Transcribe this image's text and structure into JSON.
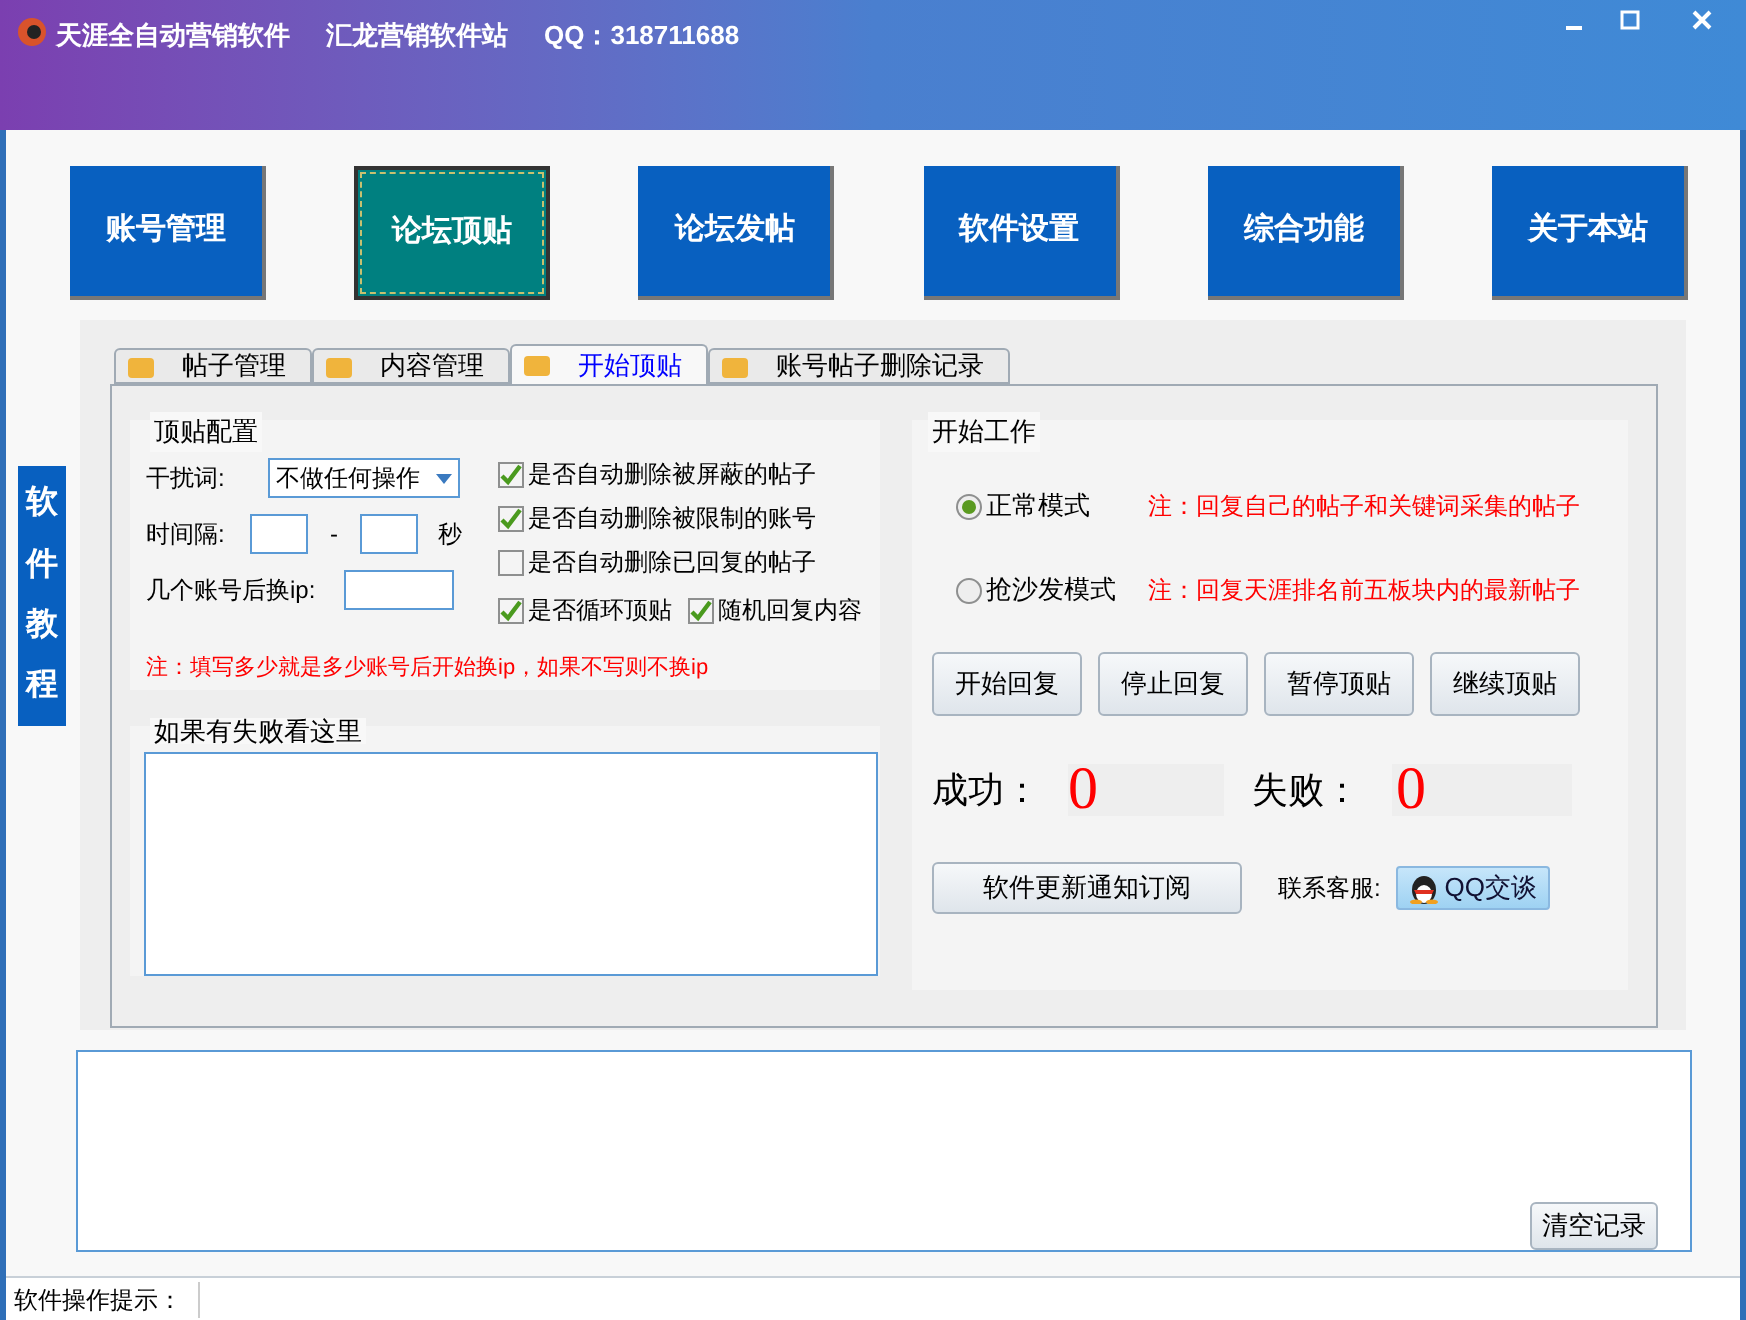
{
  "window": {
    "app_name": "天涯全自动营销软件",
    "site_name": "汇龙营销软件站",
    "qq": "QQ：318711688"
  },
  "nav_buttons": [
    {
      "label": "账号管理",
      "selected": false
    },
    {
      "label": "论坛顶贴",
      "selected": true
    },
    {
      "label": "论坛发帖",
      "selected": false
    },
    {
      "label": "软件设置",
      "selected": false
    },
    {
      "label": "综合功能",
      "selected": false
    },
    {
      "label": "关于本站",
      "selected": false
    }
  ],
  "side_tab": "软件教程",
  "tabs": [
    {
      "label": "帖子管理",
      "selected": false
    },
    {
      "label": "内容管理",
      "selected": false
    },
    {
      "label": "开始顶贴",
      "selected": true
    },
    {
      "label": "账号帖子删除记录",
      "selected": false
    }
  ],
  "config": {
    "title": "顶贴配置",
    "interference": {
      "label": "干扰词:",
      "value": "不做任何操作"
    },
    "interval": {
      "label": "时间隔:",
      "separator": "-",
      "unit": "秒"
    },
    "switch_ip": {
      "label": "几个账号后换ip:"
    },
    "options": [
      {
        "label": "是否自动删除被屏蔽的帖子",
        "checked": true
      },
      {
        "label": "是否自动删除被限制的账号",
        "checked": true
      },
      {
        "label": "是否自动删除已回复的帖子",
        "checked": false
      },
      {
        "label": "是否循环顶贴",
        "checked": true
      },
      {
        "label": "随机回复内容",
        "checked": true
      }
    ],
    "note": "注：填写多少就是多少账号后开始换ip，如果不写则不换ip"
  },
  "failure_log": {
    "title": "如果有失败看这里"
  },
  "work": {
    "title": "开始工作",
    "modes": [
      {
        "label": "正常模式",
        "selected": true,
        "note": "注：回复自己的帖子和关键词采集的帖子"
      },
      {
        "label": "抢沙发模式",
        "selected": false,
        "note": "注：回复天涯排名前五板块内的最新帖子"
      }
    ],
    "buttons": [
      "开始回复",
      "停止回复",
      "暂停顶贴",
      "继续顶贴"
    ],
    "success": {
      "label": "成功：",
      "value": "0"
    },
    "failure": {
      "label": "失败：",
      "value": "0"
    },
    "subscribe_button": "软件更新通知订阅",
    "contact_label": "联系客服:",
    "qq_button": "QQ交谈"
  },
  "log": {
    "clear_button": "清空记录"
  },
  "status_bar": {
    "label": "软件操作提示："
  }
}
